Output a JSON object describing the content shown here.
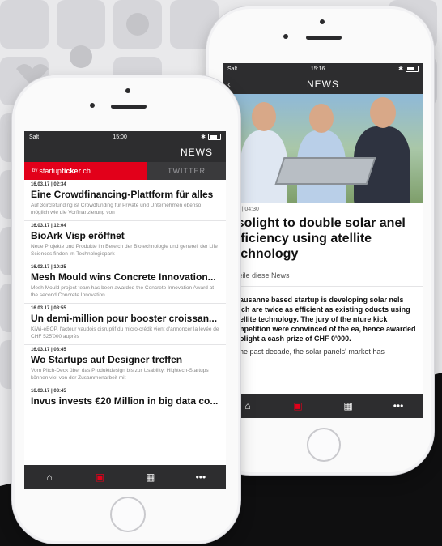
{
  "phone_left": {
    "status": {
      "carrier": "Salt",
      "time": "15:00"
    },
    "nav_title": "NEWS",
    "tabs": {
      "ticker_prefix": "by",
      "ticker_brand_a": "startup",
      "ticker_brand_b": "ticker",
      "ticker_brand_c": ".ch",
      "twitter": "TWITTER"
    },
    "items": [
      {
        "date": "16.03.17 | 02:34",
        "title": "Eine Crowdfinancing-Plattform für alles",
        "desc": "Auf 3circlefunding ist Crowdfunding für Private und Unternehmen ebenso möglich wie die Vorfinanzierung von"
      },
      {
        "date": "16.03.17 | 12:04",
        "title": "BioArk Visp eröffnet",
        "desc": "Neue Projekte und Produkte im Bereich der Biotechnologie und generell der Life Sciences finden im Technologiepark"
      },
      {
        "date": "16.03.17 | 10:25",
        "title": "Mesh Mould wins Concrete Innovation...",
        "desc": "Mesh Mould project team has been awarded the Concrete Innovation Award at the second Concrete Innovation"
      },
      {
        "date": "16.03.17 | 08:55",
        "title": "Un demi-million pour booster croissan...",
        "desc": "KiWi-eBOP, l'acteur vaudois disruptif du micro-crédit vient d'annoncer la levée de CHF 525'000 auprès"
      },
      {
        "date": "16.03.17 | 08:45",
        "title": "Wo Startups auf Designer treffen",
        "desc": "Vom Pitch-Deck über das Produktdesign bis zur Usability: Hightech-Startups können viel von der Zusammenarbeit mit"
      },
      {
        "date": "16.03.17 | 03:45",
        "title": "Invus invests €20 Million in big data co...",
        "desc": ""
      }
    ],
    "bottom": [
      "home-icon",
      "news-icon",
      "calendar-icon",
      "more-icon"
    ]
  },
  "phone_right": {
    "status": {
      "carrier": "Salt",
      "time": "15:16"
    },
    "nav_title": "NEWS",
    "meta": "2.16 | 04:30",
    "title": "nsolight to double solar anel efficiency using atellite technology",
    "share": "Teile diese News",
    "lead": "e Lausanne based startup is developing solar nels which are twice as efficient as existing oducts using satellite technology. The jury of the nture kick competition were convinced of the ea, hence awarded Insolight a cash prize of CHF 0'000.",
    "body": "er the past decade, the solar panels' market has"
  },
  "colors": {
    "accent": "#e2001a",
    "bar": "#2d2d2f"
  }
}
